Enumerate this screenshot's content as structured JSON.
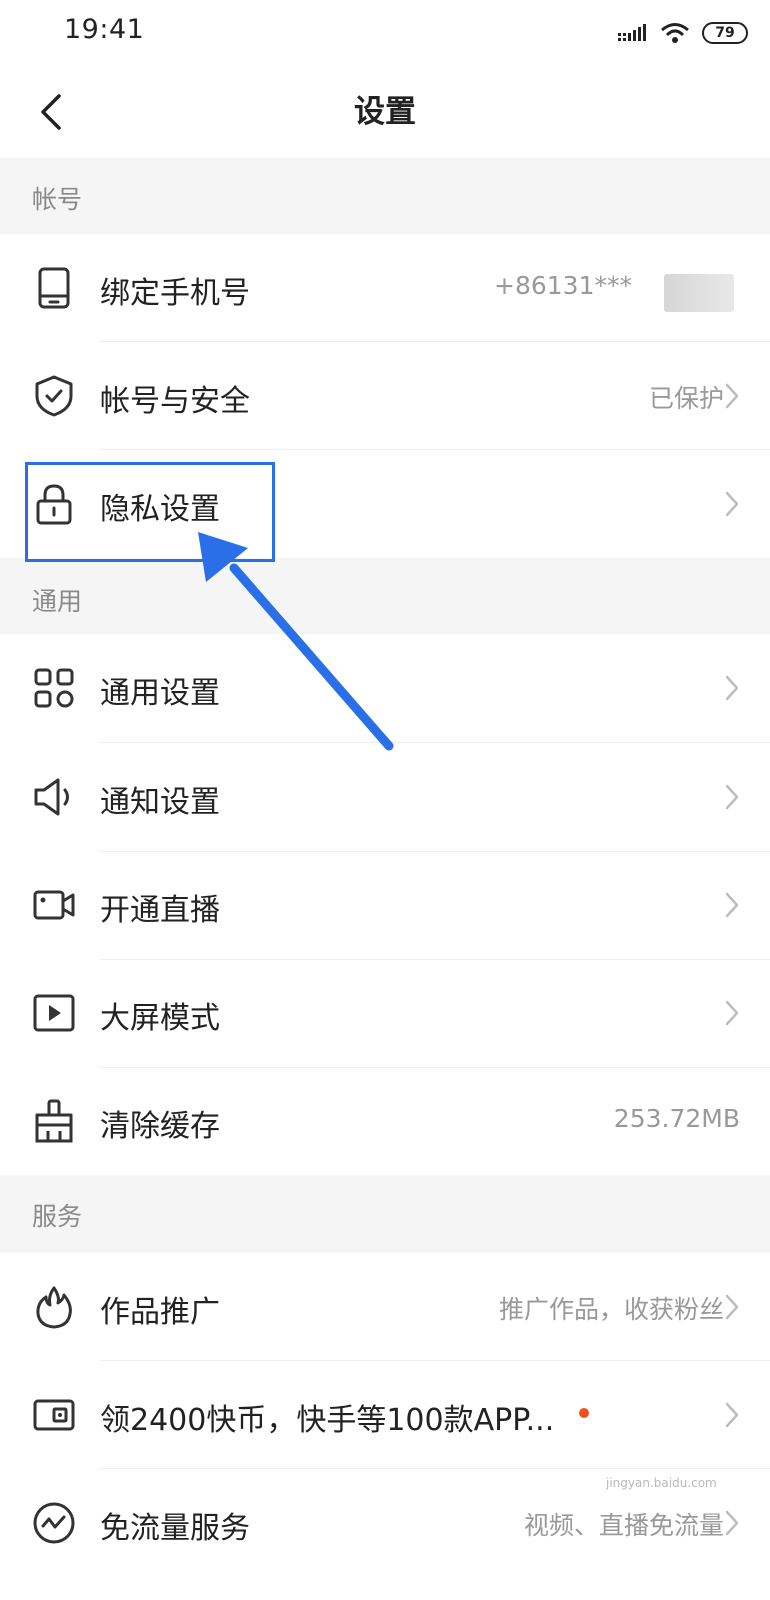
{
  "status_bar": {
    "time": "19:41",
    "battery": "79"
  },
  "header": {
    "title": "设置",
    "back_icon": "chevron-left-icon"
  },
  "sections": {
    "account": "帐号",
    "general": "通用",
    "services": "服务"
  },
  "rows": {
    "bind_phone": {
      "label": "绑定手机号",
      "value": "+86131***",
      "icon": "phone-icon"
    },
    "account_security": {
      "label": "帐号与安全",
      "value": "已保护",
      "icon": "shield-icon"
    },
    "privacy": {
      "label": "隐私设置",
      "icon": "lock-icon"
    },
    "general_settings": {
      "label": "通用设置",
      "icon": "grid-icon"
    },
    "notification": {
      "label": "通知设置",
      "icon": "speaker-icon"
    },
    "live": {
      "label": "开通直播",
      "icon": "video-camera-icon"
    },
    "big_screen": {
      "label": "大屏模式",
      "icon": "play-icon"
    },
    "clear_cache": {
      "label": "清除缓存",
      "value": "253.72MB",
      "icon": "broom-icon"
    },
    "promote": {
      "label": "作品推广",
      "value": "推广作品，收获粉丝",
      "icon": "flame-icon"
    },
    "coins": {
      "label": "领2400快币，快手等100款APP...",
      "icon": "wallet-icon"
    },
    "free_data": {
      "label": "免流量服务",
      "value": "视频、直播免流量",
      "icon": "activity-icon"
    }
  },
  "watermark": "jingyan.baidu.com",
  "colors": {
    "highlight": "#2a6fe8",
    "accent_dot": "#f0541e",
    "section_bg": "#f5f5f5"
  }
}
